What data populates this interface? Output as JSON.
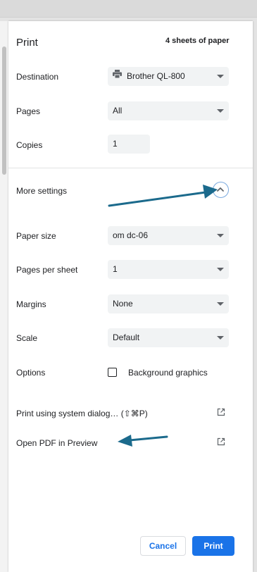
{
  "dialog": {
    "title": "Print",
    "sheets": "4 sheets of paper"
  },
  "destination": {
    "label": "Destination",
    "value": "Brother QL-800",
    "icon": "printer-icon"
  },
  "pages": {
    "label": "Pages",
    "value": "All"
  },
  "copies": {
    "label": "Copies",
    "value": "1"
  },
  "more_settings": {
    "label": "More settings",
    "icon": "chevron-up-icon",
    "expanded": true
  },
  "paper_size": {
    "label": "Paper size",
    "value": "om dc-06"
  },
  "pages_per_sheet": {
    "label": "Pages per sheet",
    "value": "1"
  },
  "margins": {
    "label": "Margins",
    "value": "None"
  },
  "scale": {
    "label": "Scale",
    "value": "Default"
  },
  "options": {
    "label": "Options",
    "checkbox_label": "Background graphics",
    "checked": false
  },
  "links": {
    "system_dialog": "Print using system dialog… (⇧⌘P)",
    "open_pdf": "Open PDF in Preview",
    "icon": "open-external-icon"
  },
  "buttons": {
    "cancel": "Cancel",
    "print": "Print"
  },
  "colors": {
    "accent": "#1a73e8",
    "annotation_arrow": "#1b6a8c",
    "field_bg": "#f1f3f4"
  }
}
